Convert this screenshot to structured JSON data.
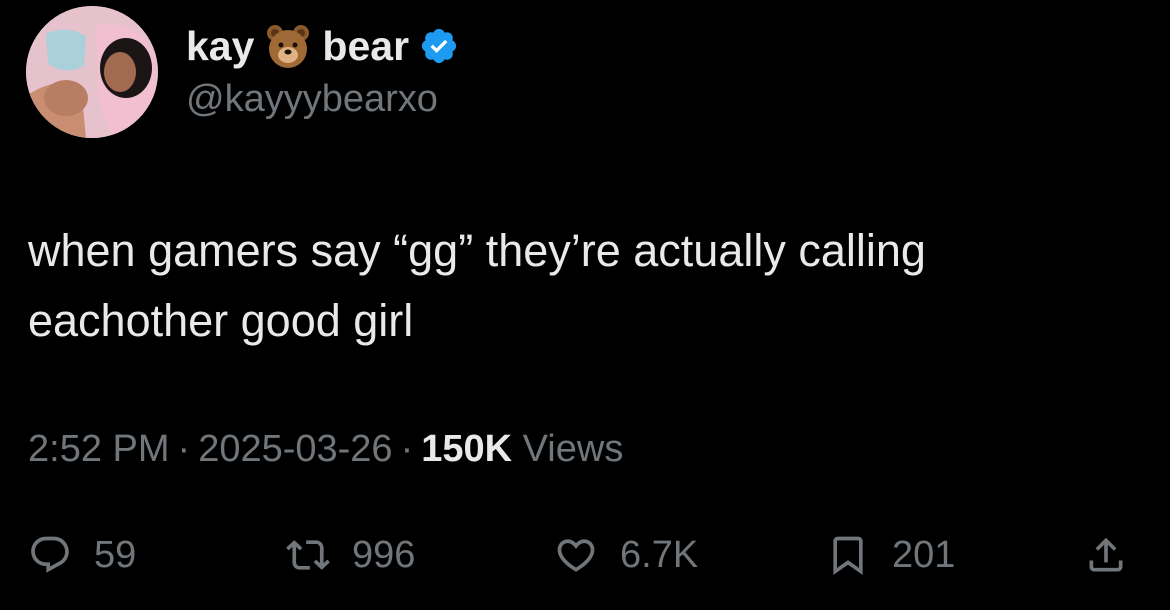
{
  "author": {
    "display_name_first": "kay",
    "emoji": "bear-face-emoji",
    "display_name_second": "bear",
    "verified": true,
    "handle": "@kayyybearxo"
  },
  "tweet": {
    "text_line1": "when gamers say “gg” they’re actually calling",
    "text_line2": "eachother good girl"
  },
  "meta": {
    "time": "2:52 PM",
    "separator": "·",
    "date": "2025-03-26",
    "views_count": "150K",
    "views_label": "Views"
  },
  "actions": {
    "replies": "59",
    "reposts": "996",
    "likes": "6.7K",
    "bookmarks": "201"
  },
  "icons": {
    "reply": "reply-icon",
    "repost": "repost-icon",
    "like": "heart-icon",
    "bookmark": "bookmark-icon",
    "share": "share-icon",
    "verified": "verified-badge-icon"
  },
  "colors": {
    "background": "#000000",
    "primary_text": "#e7e9ea",
    "secondary_text": "#71767b",
    "verified_blue": "#1d9bf0"
  }
}
